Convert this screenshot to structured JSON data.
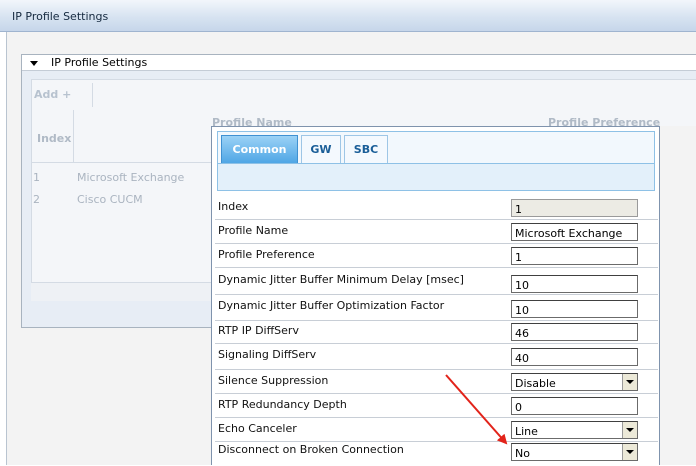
{
  "window": {
    "title": "IP Profile Settings"
  },
  "group": {
    "title": "IP Profile Settings"
  },
  "table": {
    "add_label": "Add +",
    "columns": [
      "Index",
      "Profile Name",
      "Profile Preference"
    ],
    "rows": [
      {
        "index": "1",
        "name": "Microsoft Exchange"
      },
      {
        "index": "2",
        "name": "Cisco CUCM"
      }
    ]
  },
  "dialog": {
    "tabs": [
      "Common",
      "GW",
      "SBC"
    ],
    "active_tab": "Common",
    "fields": [
      {
        "label": "Index",
        "value": "1",
        "type": "readonly"
      },
      {
        "label": "Profile Name",
        "value": "Microsoft Exchange",
        "type": "text"
      },
      {
        "label": "Profile Preference",
        "value": "1",
        "type": "text"
      },
      {
        "label": "Dynamic Jitter Buffer Minimum Delay [msec]",
        "value": "10",
        "type": "text"
      },
      {
        "label": "Dynamic Jitter Buffer Optimization Factor",
        "value": "10",
        "type": "text"
      },
      {
        "label": "RTP IP DiffServ",
        "value": "46",
        "type": "text"
      },
      {
        "label": "Signaling DiffServ",
        "value": "40",
        "type": "text"
      },
      {
        "label": "Silence Suppression",
        "value": "Disable",
        "type": "select"
      },
      {
        "label": "RTP Redundancy Depth",
        "value": "0",
        "type": "text"
      },
      {
        "label": "Echo Canceler",
        "value": "Line",
        "type": "select"
      },
      {
        "label": "Disconnect on Broken Connection",
        "value": "No",
        "type": "select"
      }
    ]
  },
  "colors": {
    "annotation_arrow": "#e2231a",
    "tab_active": "#4fa6e5",
    "title_bar": "#d7e3f1"
  },
  "icons": {
    "collapse": "triangle-down-icon",
    "dropdown": "chevron-down-icon",
    "annotation": "red-arrow-icon"
  }
}
